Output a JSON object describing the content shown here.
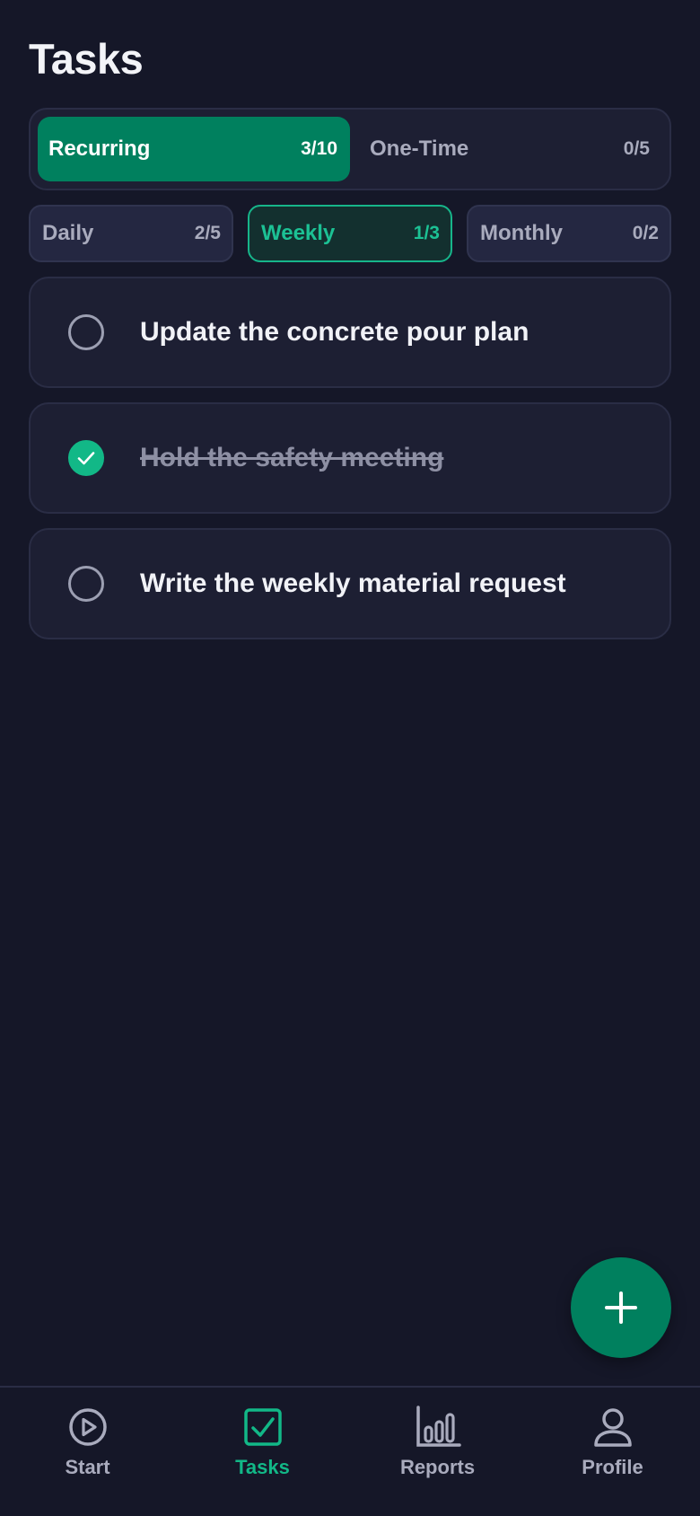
{
  "page": {
    "title": "Tasks"
  },
  "segments": [
    {
      "label": "Recurring",
      "count": "3/10",
      "active": true
    },
    {
      "label": "One-Time",
      "count": "0/5",
      "active": false
    }
  ],
  "subtabs": [
    {
      "label": "Daily",
      "count": "2/5",
      "active": false
    },
    {
      "label": "Weekly",
      "count": "1/3",
      "active": true
    },
    {
      "label": "Monthly",
      "count": "0/2",
      "active": false
    }
  ],
  "tasks": [
    {
      "text": "Update the concrete pour plan",
      "done": false
    },
    {
      "text": "Hold the safety meeting",
      "done": true
    },
    {
      "text": "Write the weekly material request",
      "done": false
    }
  ],
  "fab": {
    "icon": "plus-icon"
  },
  "nav": [
    {
      "label": "Start",
      "icon": "play-circle-icon",
      "active": false
    },
    {
      "label": "Tasks",
      "icon": "checkbox-icon",
      "active": true
    },
    {
      "label": "Reports",
      "icon": "bar-chart-icon",
      "active": false
    },
    {
      "label": "Profile",
      "icon": "user-icon",
      "active": false
    }
  ],
  "colors": {
    "background": "#151728",
    "accent": "#00805E",
    "accent_bright": "#12B887",
    "card": "#1D1F33"
  }
}
